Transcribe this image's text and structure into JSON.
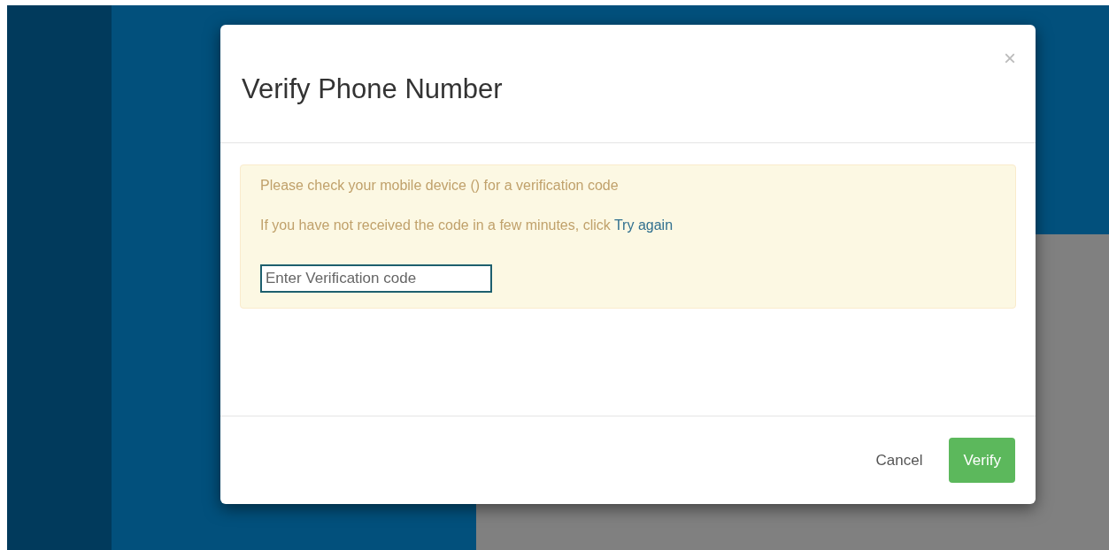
{
  "dialog": {
    "title": "Verify Phone Number",
    "close": "×",
    "alert": {
      "message": "Please check your mobile device () for a verification code",
      "retry_text": "If you have not received the code in a few minutes, click",
      "retry_link": "Try again"
    },
    "code_field": {
      "placeholder": "Enter Verification code"
    },
    "buttons": [
      {
        "label": "Cancel",
        "kind": "link"
      },
      {
        "label": "Verify",
        "kind": "primary"
      }
    ]
  }
}
